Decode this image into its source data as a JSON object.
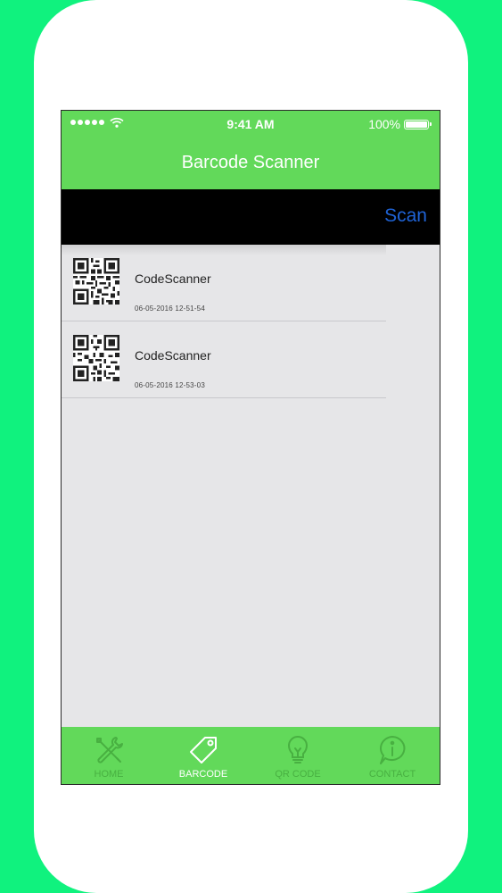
{
  "status_bar": {
    "time": "9:41 AM",
    "battery": "100%"
  },
  "nav_bar": {
    "title": "Barcode Scanner"
  },
  "toolbar": {
    "scan_label": "Scan"
  },
  "history": [
    {
      "title": "CodeScanner",
      "date": "06-05-2016 12-51-54"
    },
    {
      "title": "CodeScanner",
      "date": "06-05-2016 12-53-03"
    }
  ],
  "tabs": [
    {
      "label": "HOME",
      "icon": "tools-icon",
      "active": false
    },
    {
      "label": "BARCODE",
      "icon": "tag-icon",
      "active": true
    },
    {
      "label": "QR CODE",
      "icon": "lightbulb-icon",
      "active": false
    },
    {
      "label": "CONTACT",
      "icon": "info-icon",
      "active": false
    }
  ],
  "colors": {
    "background": "#10f27e",
    "accent": "#62d95a",
    "scan_link": "#1f63d6"
  }
}
